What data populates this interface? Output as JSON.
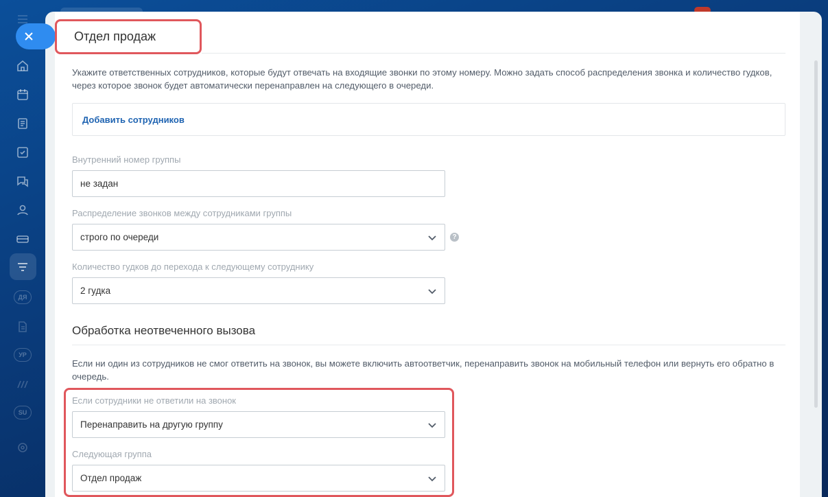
{
  "panel": {
    "title": "Отдел продаж",
    "description": "Укажите ответственных сотрудников, которые будут отвечать на входящие звонки по этому номеру. Можно задать способ распределения звонка и количество гудков, через которое звонок будет автоматически перенаправлен на следующего в очереди.",
    "add_employees_label": "Добавить сотрудников"
  },
  "fields": {
    "internal_number": {
      "label": "Внутренний номер группы",
      "value": "не задан"
    },
    "distribution": {
      "label": "Распределение звонков между сотрудниками группы",
      "value": "строго по очереди"
    },
    "rings": {
      "label": "Количество гудков до перехода к следующему сотруднику",
      "value": "2 гудка"
    }
  },
  "unanswered": {
    "title": "Обработка неотвеченного вызова",
    "description": "Если ни один из сотрудников не смог ответить на звонок, вы можете включить автоответчик, перенаправить звонок на мобильный телефон или вернуть его обратно в очередь.",
    "if_no_answer": {
      "label": "Если сотрудники не ответили на звонок",
      "value": "Перенаправить на другую группу"
    },
    "next_group": {
      "label": "Следующая группа",
      "value": "Отдел продаж"
    }
  },
  "nav": {
    "badges": [
      "ДЯ",
      "УР",
      "SU"
    ]
  },
  "colors": {
    "accent": "#2f8cf0",
    "highlight": "#e0575c",
    "link": "#1f64b2"
  }
}
